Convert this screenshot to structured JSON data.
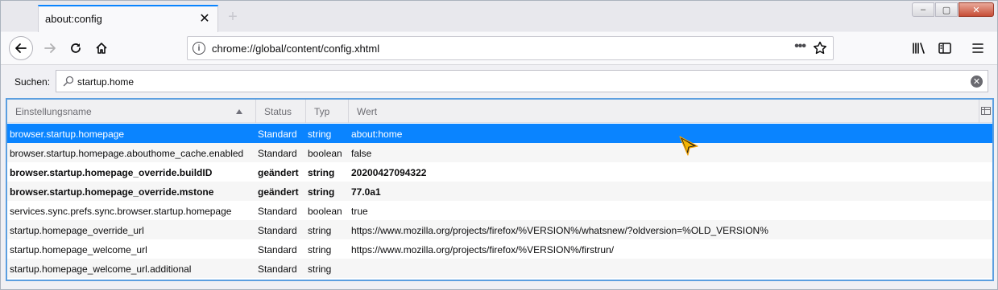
{
  "tab": {
    "title": "about:config",
    "close_glyph": "✕",
    "newtab_glyph": "+"
  },
  "window_controls": {
    "minimize_glyph": "–",
    "maximize_glyph": "▢",
    "close_glyph": "✕"
  },
  "navbar": {
    "url": "chrome://global/content/config.xhtml",
    "info_glyph": "i",
    "page_actions_glyph": "•••"
  },
  "search": {
    "label": "Suchen:",
    "value": "startup.home",
    "clear_glyph": "✕"
  },
  "table": {
    "headers": {
      "name": "Einstellungsname",
      "status": "Status",
      "typ": "Typ",
      "wert": "Wert"
    },
    "rows": [
      {
        "name": "browser.startup.homepage",
        "status": "Standard",
        "typ": "string",
        "wert": "about:home"
      },
      {
        "name": "browser.startup.homepage.abouthome_cache.enabled",
        "status": "Standard",
        "typ": "boolean",
        "wert": "false"
      },
      {
        "name": "browser.startup.homepage_override.buildID",
        "status": "geändert",
        "typ": "string",
        "wert": "20200427094322"
      },
      {
        "name": "browser.startup.homepage_override.mstone",
        "status": "geändert",
        "typ": "string",
        "wert": "77.0a1"
      },
      {
        "name": "services.sync.prefs.sync.browser.startup.homepage",
        "status": "Standard",
        "typ": "boolean",
        "wert": "true"
      },
      {
        "name": "startup.homepage_override_url",
        "status": "Standard",
        "typ": "string",
        "wert": "https://www.mozilla.org/projects/firefox/%VERSION%/whatsnew/?oldversion=%OLD_VERSION%"
      },
      {
        "name": "startup.homepage_welcome_url",
        "status": "Standard",
        "typ": "string",
        "wert": "https://www.mozilla.org/projects/firefox/%VERSION%/firstrun/"
      },
      {
        "name": "startup.homepage_welcome_url.additional",
        "status": "Standard",
        "typ": "string",
        "wert": ""
      }
    ]
  },
  "colors": {
    "accent": "#0a84ff",
    "selection": "#0a84ff",
    "focus_border": "#5c9fe0"
  }
}
